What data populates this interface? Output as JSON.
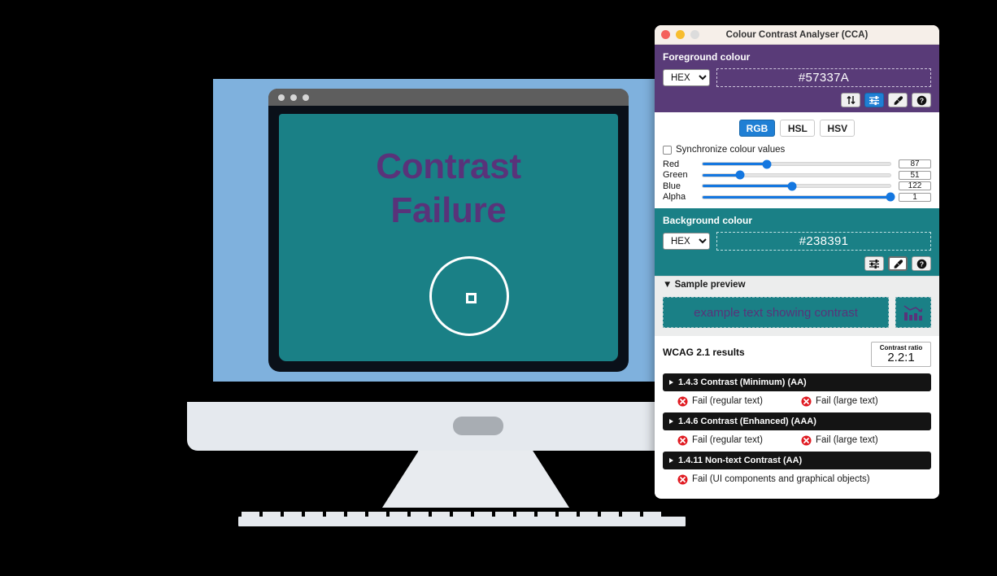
{
  "scene": {
    "browser": {
      "name": "browser-window-mock",
      "dots_count": 3,
      "page_text_line1": "Contrast",
      "page_text_line2": "Failure",
      "page_background_color": "#1a8086",
      "page_text_color": "#59337a",
      "magnifier": "eyedropper-magnifier"
    },
    "monitor": {
      "bezel_color": "#7fb1dd",
      "body_color": "#e5e9ee"
    }
  },
  "app": {
    "title": "Colour Contrast Analyser (CCA)",
    "window_controls": {
      "close": "close",
      "minimize": "minimize",
      "maximize": "maximize"
    },
    "foreground": {
      "label": "Foreground colour",
      "format_selected": "HEX",
      "format_options": [
        "HEX",
        "RGB",
        "HSL",
        "HSV"
      ],
      "value": "#57337A",
      "section_color": "#593b78",
      "icons": [
        {
          "name": "swap-colours-icon",
          "glyph": "swap",
          "active": false
        },
        {
          "name": "colour-sliders-icon",
          "glyph": "sliders",
          "active": true
        },
        {
          "name": "eyedropper-icon",
          "glyph": "eyedropper",
          "active": false
        },
        {
          "name": "help-icon",
          "glyph": "help",
          "active": false
        }
      ]
    },
    "colour_model": {
      "tabs": [
        {
          "label": "RGB",
          "active": true
        },
        {
          "label": "HSL",
          "active": false
        },
        {
          "label": "HSV",
          "active": false
        }
      ],
      "sync_label": "Synchronize colour values",
      "sync_checked": false,
      "sliders": [
        {
          "name": "Red",
          "value": "87",
          "percent": 34.1
        },
        {
          "name": "Green",
          "value": "51",
          "percent": 20.0
        },
        {
          "name": "Blue",
          "value": "122",
          "percent": 47.8
        },
        {
          "name": "Alpha",
          "value": "1",
          "percent": 100
        }
      ]
    },
    "background": {
      "label": "Background colour",
      "format_selected": "HEX",
      "value": "#238391",
      "section_color": "#1a8086",
      "icons": [
        {
          "name": "colour-sliders-icon",
          "glyph": "sliders",
          "active": false
        },
        {
          "name": "eyedropper-icon",
          "glyph": "eyedropper",
          "active": true
        },
        {
          "name": "help-icon",
          "glyph": "help",
          "active": false
        }
      ]
    },
    "sample_preview": {
      "label": "Sample preview",
      "expanded": true,
      "sample_text": "example text showing contrast",
      "graphic_icon": "bar-chart-icon",
      "sample_bg": "#238391",
      "sample_fg": "#57337A"
    },
    "results": {
      "title": "WCAG 2.1 results",
      "ratio_label": "Contrast ratio",
      "ratio_value": "2.2:1",
      "criteria": [
        {
          "id": "1.4.3 Contrast (Minimum) (AA)",
          "outcomes": [
            "Fail (regular text)",
            "Fail (large text)"
          ]
        },
        {
          "id": "1.4.6 Contrast (Enhanced) (AAA)",
          "outcomes": [
            "Fail (regular text)",
            "Fail (large text)"
          ]
        },
        {
          "id": "1.4.11 Non-text Contrast (AA)",
          "outcomes": [
            "Fail (UI components and graphical objects)"
          ]
        }
      ]
    }
  }
}
